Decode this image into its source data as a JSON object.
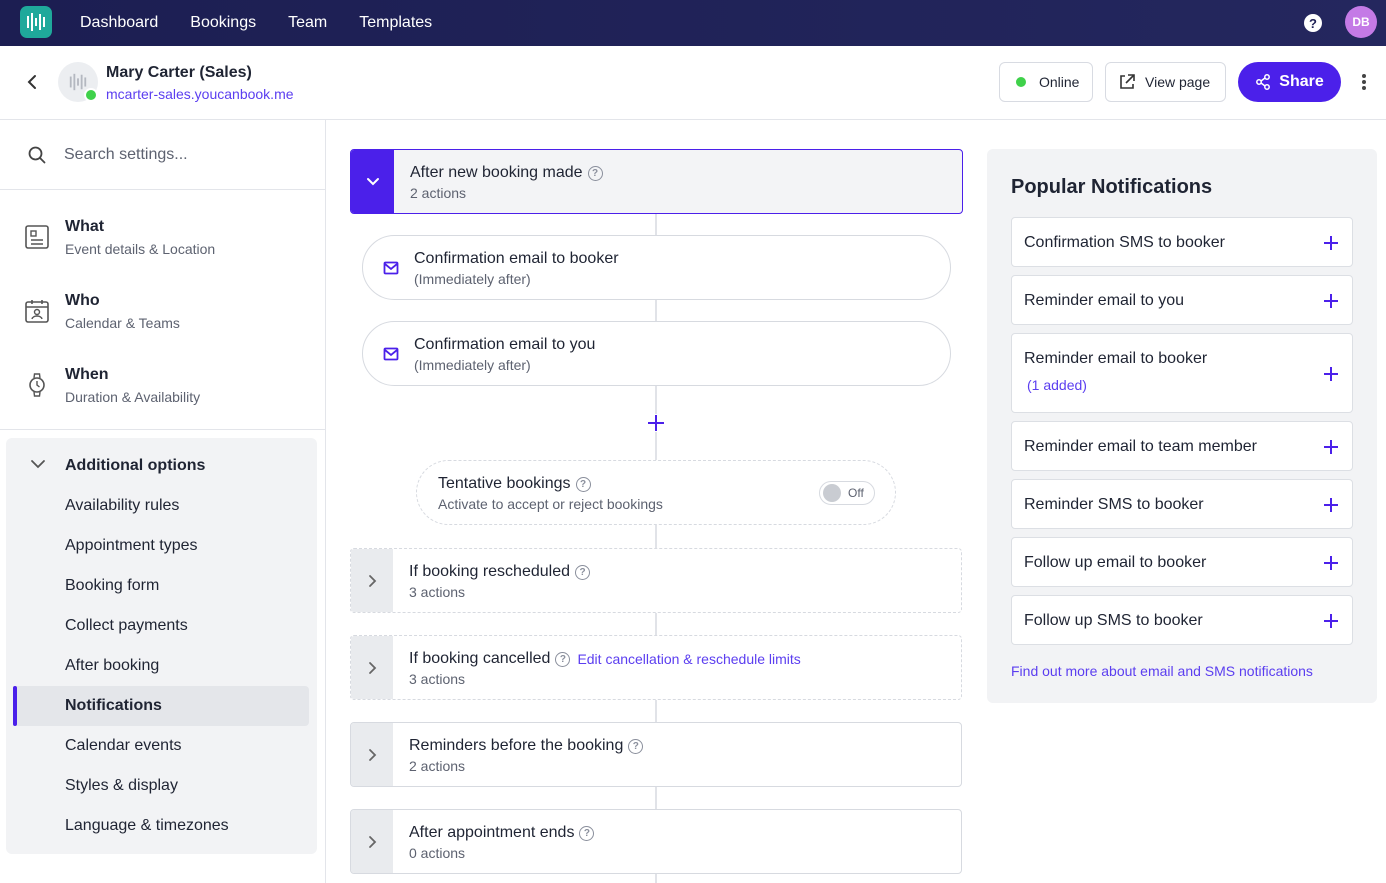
{
  "nav": {
    "links": [
      "Dashboard",
      "Bookings",
      "Team",
      "Templates"
    ],
    "help_icon": "question-icon",
    "avatar_initials": "DB"
  },
  "header": {
    "page_name": "Mary Carter (Sales)",
    "page_url": "mcarter-sales.youcanbook.me",
    "status_label": "Online",
    "view_page_label": "View page",
    "share_label": "Share"
  },
  "sidebar": {
    "search_placeholder": "Search settings...",
    "sections": [
      {
        "title": "What",
        "subtitle": "Event details & Location",
        "icon": "document-icon"
      },
      {
        "title": "Who",
        "subtitle": "Calendar & Teams",
        "icon": "calendar-person-icon"
      },
      {
        "title": "When",
        "subtitle": "Duration & Availability",
        "icon": "watch-icon"
      }
    ],
    "additional": {
      "title": "Additional options",
      "items": [
        "Availability rules",
        "Appointment types",
        "Booking form",
        "Collect payments",
        "After booking",
        "Notifications",
        "Calendar events",
        "Styles & display",
        "Language & timezones"
      ],
      "active": "Notifications"
    }
  },
  "main": {
    "after_new": {
      "title": "After new booking made",
      "subtitle": "2 actions"
    },
    "actions": [
      {
        "title": "Confirmation email to booker",
        "subtitle": "(Immediately after)"
      },
      {
        "title": "Confirmation email to you",
        "subtitle": "(Immediately after)"
      }
    ],
    "tentative": {
      "title": "Tentative bookings",
      "subtitle": "Activate to accept or reject bookings",
      "toggle_label": "Off"
    },
    "rescheduled": {
      "title": "If booking rescheduled",
      "subtitle": "3 actions"
    },
    "cancelled": {
      "title": "If booking cancelled",
      "link": "Edit cancellation & reschedule limits",
      "subtitle": "3 actions"
    },
    "reminders": {
      "title": "Reminders before the booking",
      "subtitle": "2 actions"
    },
    "after_end": {
      "title": "After appointment ends",
      "subtitle": "0 actions"
    }
  },
  "popular": {
    "title": "Popular Notifications",
    "items": [
      {
        "label": "Confirmation SMS to booker"
      },
      {
        "label": "Reminder email to you"
      },
      {
        "label": "Reminder email to booker",
        "added": "(1 added)"
      },
      {
        "label": "Reminder email to team member"
      },
      {
        "label": "Reminder SMS to booker"
      },
      {
        "label": "Follow up email to booker"
      },
      {
        "label": "Follow up SMS to booker"
      }
    ],
    "footer_link": "Find out more about email and SMS notifications"
  },
  "colors": {
    "accent": "#4b20ea",
    "nav_bg": "#1c1e52",
    "online": "#3fd14a",
    "logo": "#1fa99b"
  }
}
